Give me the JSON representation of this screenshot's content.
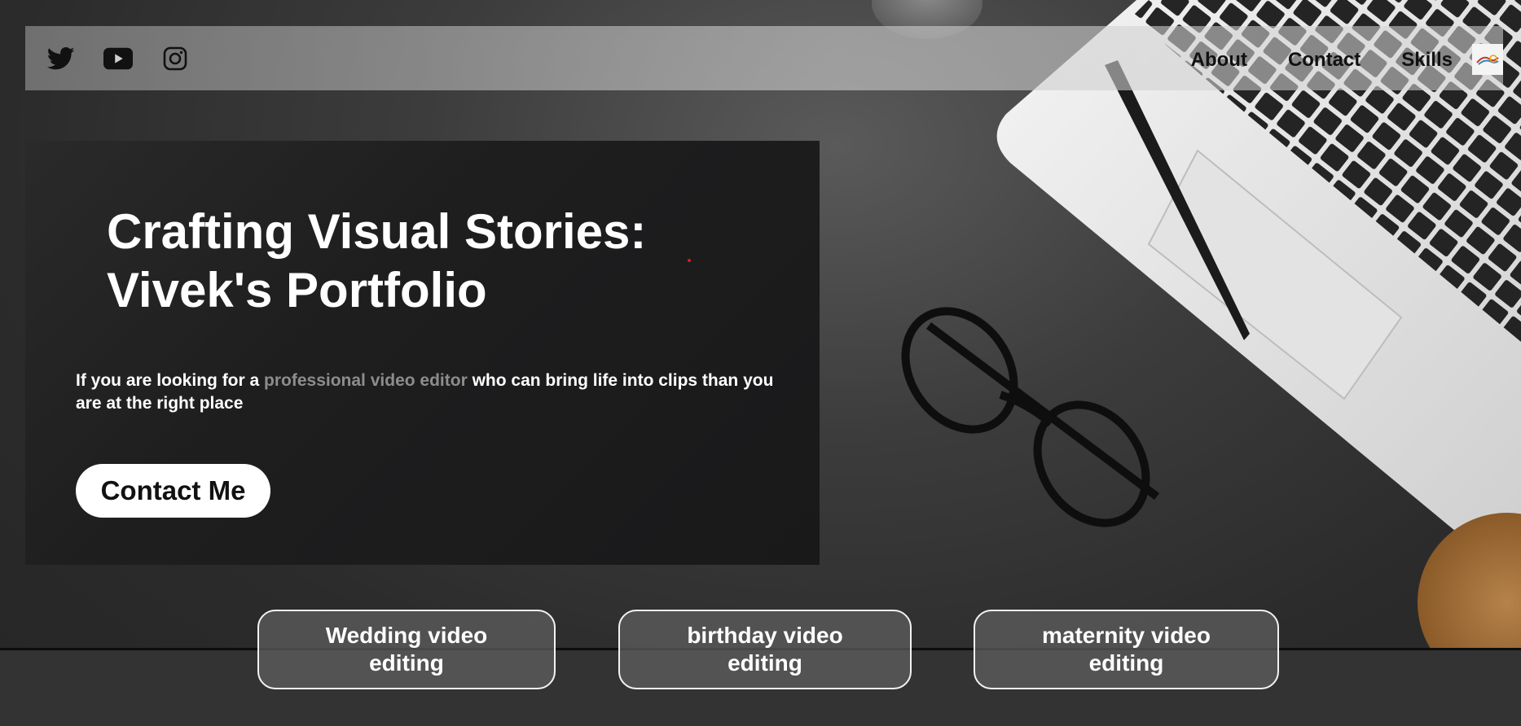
{
  "navbar": {
    "social": [
      {
        "icon": "twitter-icon"
      },
      {
        "icon": "youtube-icon"
      },
      {
        "icon": "instagram-icon"
      }
    ],
    "links": [
      "About",
      "Contact",
      "Skills"
    ],
    "logo_icon": "logo-icon"
  },
  "hero": {
    "title_line1": "Crafting Visual Stories:",
    "title_line2": "Vivek's Portfolio",
    "desc_before": "If you are looking for a ",
    "desc_highlight": "professional video editor",
    "desc_after": " who can bring life into clips than you are at the right place",
    "cta_label": "Contact Me"
  },
  "services": [
    {
      "line1": "Wedding video",
      "line2": "editing"
    },
    {
      "line1": "birthday video",
      "line2": "editing"
    },
    {
      "line1": "maternity video",
      "line2": "editing"
    }
  ],
  "colors": {
    "background": "#2b2b2b",
    "hero_card": "#1e1e1f",
    "highlight_text": "#8d8d8d",
    "bottom_strip": "#333333"
  }
}
